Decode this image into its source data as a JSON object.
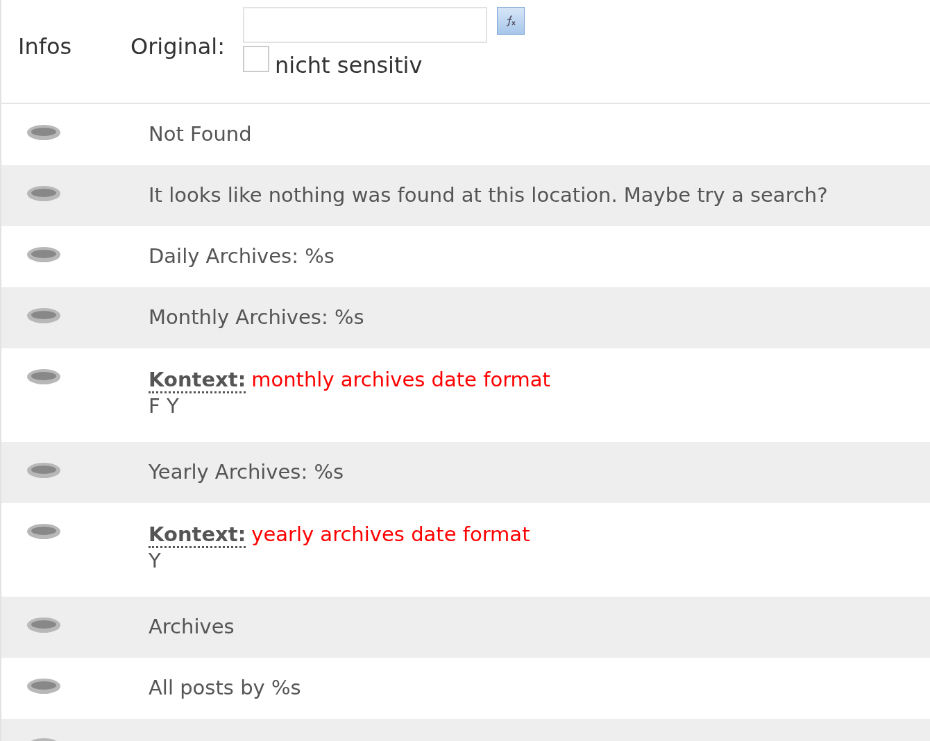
{
  "header": {
    "column_1": "Infos",
    "column_2": "Original:",
    "case_insensitive": {
      "label": "nicht sensitiv",
      "checked": false
    }
  },
  "rows": [
    {
      "kind": "plain",
      "text": "Not Found"
    },
    {
      "kind": "plain",
      "text": "It looks like nothing was found at this location. Maybe try a search?"
    },
    {
      "kind": "plain",
      "text": "Daily Archives: %s"
    },
    {
      "kind": "plain",
      "text": "Monthly Archives: %s"
    },
    {
      "kind": "context",
      "context_label": "Kontext:",
      "context": "monthly archives date format",
      "text": "F Y"
    },
    {
      "kind": "plain",
      "text": "Yearly Archives: %s"
    },
    {
      "kind": "context",
      "context_label": "Kontext:",
      "context": "yearly archives date format",
      "text": "Y"
    },
    {
      "kind": "plain",
      "text": "Archives"
    },
    {
      "kind": "plain",
      "text": "All posts by %s"
    },
    {
      "kind": "cut"
    }
  ]
}
